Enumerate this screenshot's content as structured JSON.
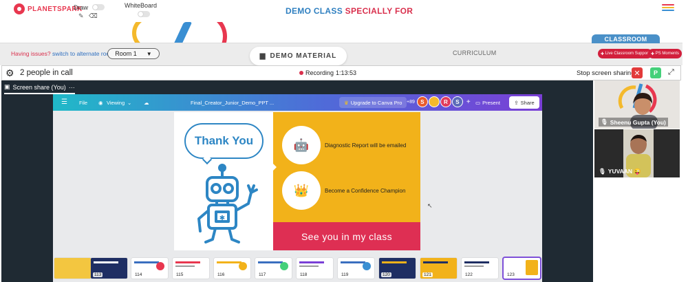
{
  "header": {
    "logo_text": "PLANETSPARK",
    "draw_label": "Draw",
    "whiteboard_label": "WhiteBoard",
    "title_part1": "DEMO CLASS",
    "title_part2": "SPECIALLY FOR",
    "menu_colors": [
      "#e8374f",
      "#f4b92c",
      "#3a8fd3",
      "#45d07a"
    ]
  },
  "nav": {
    "issues_text": "Having issues?",
    "switch_link": "switch to alternate room",
    "room_value": "Room 1",
    "demo_material": "DEMO MATERIAL",
    "curriculum": "CURRICULUM",
    "classroom_tab": "CLASSROOM",
    "live_support": "Live Classroom Support",
    "ps_moments": "PS Moments"
  },
  "callbar": {
    "people": "2 people in call",
    "recording_label": "Recording",
    "recording_time": "1:13:53",
    "stop_share": "Stop screen sharing",
    "p_label": "P"
  },
  "share": {
    "tab_label": "Screen share (You)",
    "tab_more": "···"
  },
  "canva": {
    "file": "File",
    "viewing": "Viewing",
    "doc_name": "Final_Creator_Junior_Demo_PPT ...",
    "upgrade": "Upgrade to Canva Pro",
    "collab_count": "+89",
    "avatars": [
      {
        "letter": "S",
        "color": "#e85a2c"
      },
      {
        "letter": "",
        "color": "#f4b92c"
      },
      {
        "letter": "R",
        "color": "#e23a5a"
      },
      {
        "letter": "S",
        "color": "#5a6ab8"
      }
    ],
    "present": "Present",
    "share": "Share"
  },
  "slide": {
    "thank_you": "Thank You",
    "row1": "Diagnostic Report will be emailed",
    "row2": "Become a Confidence Champion",
    "footer": "See you in my class"
  },
  "thumbnails": [
    {
      "num": "",
      "dark": false
    },
    {
      "num": "113",
      "dark": true
    },
    {
      "num": "114",
      "dark": false
    },
    {
      "num": "115",
      "dark": false
    },
    {
      "num": "116",
      "dark": false
    },
    {
      "num": "117",
      "dark": false
    },
    {
      "num": "118",
      "dark": false
    },
    {
      "num": "119",
      "dark": false
    },
    {
      "num": "120",
      "dark": true
    },
    {
      "num": "121",
      "dark": false
    },
    {
      "num": "122",
      "dark": false
    },
    {
      "num": "123",
      "dark": false
    }
  ],
  "participants": [
    {
      "name": "Sheenu Gupta (You)"
    },
    {
      "name": "YUVAAN 😜"
    }
  ]
}
